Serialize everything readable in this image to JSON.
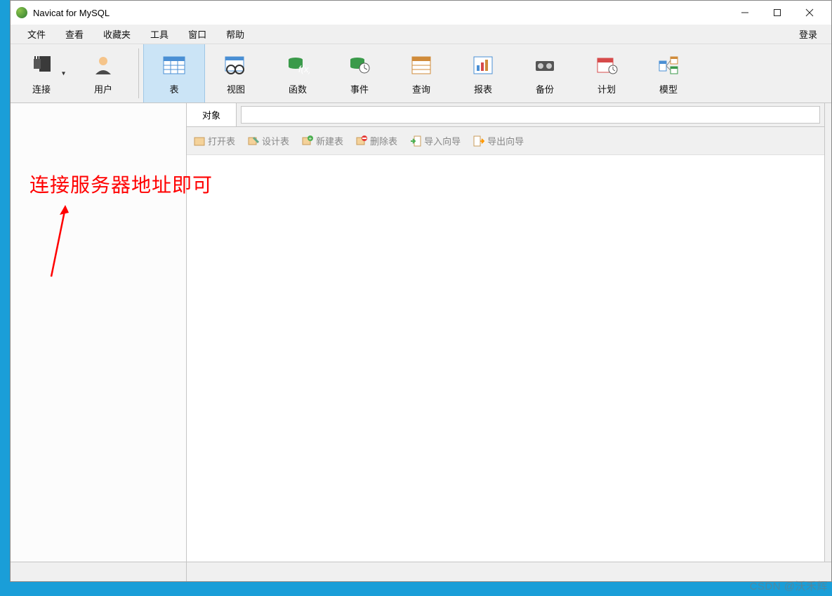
{
  "title": "Navicat for MySQL",
  "menu": {
    "items": [
      "文件",
      "查看",
      "收藏夹",
      "工具",
      "窗口",
      "帮助"
    ],
    "login": "登录"
  },
  "toolbar": {
    "connect": "连接",
    "user": "用户",
    "table": "表",
    "view": "视图",
    "function": "函数",
    "event": "事件",
    "query": "查询",
    "report": "报表",
    "backup": "备份",
    "schedule": "计划",
    "model": "模型"
  },
  "tabs": {
    "objects": "对象"
  },
  "actions": {
    "open_table": "打开表",
    "design_table": "设计表",
    "new_table": "新建表",
    "delete_table": "删除表",
    "import_wizard": "导入向导",
    "export_wizard": "导出向导"
  },
  "annotation": "连接服务器地址即可",
  "watermark": "CSDN @沃禾辉"
}
